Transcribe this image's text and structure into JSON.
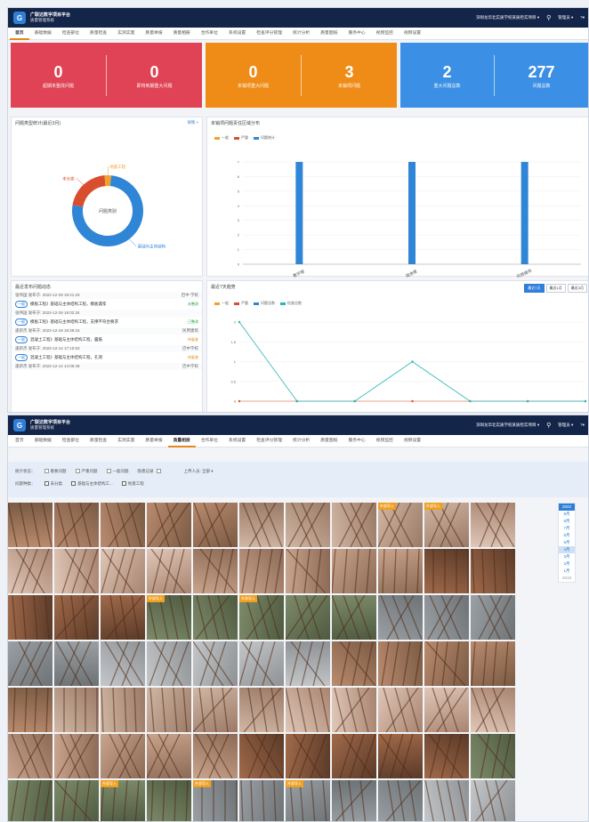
{
  "app": {
    "title": "广联达数字项目平台",
    "subtitle": "质量管理系统",
    "project": "深圳龙华北实质学校某质检实项目",
    "user": "管理员"
  },
  "nav": [
    "首页",
    "基础数据",
    "检查部位",
    "质量检查",
    "实测实量",
    "质量举报",
    "质量相册",
    "合作单位",
    "系统设置",
    "检查评分管理",
    "统计分析",
    "质量图纸",
    "服务中心",
    "视频监控",
    "视频设置"
  ],
  "stats": [
    {
      "v1": "0",
      "l1": "超期未整改问题",
      "v2": "0",
      "l2": "即将到期重大问题"
    },
    {
      "v1": "0",
      "l1": "未销项重大问题",
      "v2": "3",
      "l2": "未销项问题"
    },
    {
      "v1": "2",
      "l1": "重大问题总数",
      "v2": "277",
      "l2": "问题总数"
    }
  ],
  "donut": {
    "title": "问题类型统计(最近3月)",
    "link": "详情 >",
    "center": "问题类别",
    "labels": [
      "地基工程",
      "未分类",
      "基础与主体结构"
    ]
  },
  "bar": {
    "title": "未销项问题责任区域分布",
    "legend": [
      "一般",
      "严重",
      "问题统计"
    ]
  },
  "feed": {
    "title": "最近发布问题动态",
    "items": [
      {
        "who": "张伟国 发布于: 2022-12-29 19:21:33",
        "loc": "巴中 学校",
        "tag": "一般",
        "text": "模板工程》基础与主体结构工程，模板漏浆",
        "st": "未整改",
        "cls": "ok"
      },
      {
        "who": "张伟国 发布于: 2022-12-29 19:02:34",
        "loc": "",
        "tag": "一般",
        "text": "模板工程》基础与主体结构工程，支撑不符合要求",
        "st": "已整改",
        "cls": "ok"
      },
      {
        "who": "逢新杰 发布于: 2022-12-19 18:38:16",
        "loc": "民用建筑",
        "tag": "一般",
        "text": "混凝土工程》基础与主体结构工程，露筋",
        "st": "待复查",
        "cls": "bad"
      },
      {
        "who": "逢新杰 发布于: 2022-12-14 17:15:53",
        "loc": "巴中学校",
        "tag": "一般",
        "text": "混凝土工程》基础与主体结构工程，孔洞",
        "st": "待复查",
        "cls": "bad"
      },
      {
        "who": "逢新杰 发布于: 2022-12-14 14:06:48",
        "loc": "巴中学校",
        "tag": "",
        "text": "",
        "st": "",
        "cls": "ok"
      }
    ]
  },
  "trend": {
    "title": "最近7天趋势",
    "tabs": [
      "最近7天",
      "最近1月",
      "最近3月"
    ],
    "legend": [
      "一般",
      "严重",
      "问题总数",
      "检查总数"
    ]
  },
  "filters": {
    "row1_label": "统计状态：",
    "row1": [
      "重要问题",
      "严重问题",
      "一般问题"
    ],
    "row1_b": "隐患记录",
    "person": "上传人员: 全部 ▾",
    "row2_label": "问题种类：",
    "row2": [
      "未分类",
      "基础与主体结构工...",
      "地基工程"
    ]
  },
  "album": {
    "import_label": "外部导入",
    "year": "2022",
    "months": [
      "9月",
      "8月",
      "7月",
      "6月",
      "5月",
      "4月",
      "3月",
      "2月",
      "1月"
    ],
    "old_year": "2018"
  },
  "chart_data": [
    {
      "type": "pie",
      "title": "问题类型统计(最近3月)",
      "categories": [
        "基础与主体结构",
        "未分类",
        "地基工程"
      ],
      "values": [
        76,
        21,
        3
      ],
      "colors": [
        "#2f86d6",
        "#d84e2e",
        "#f0a22a"
      ]
    },
    {
      "type": "bar",
      "title": "未销项问题责任区域分布",
      "categories": [
        "教学楼",
        "宿舍楼",
        "风雨操场"
      ],
      "series": [
        {
          "name": "一般",
          "values": [
            0,
            0,
            0
          ]
        },
        {
          "name": "严重",
          "values": [
            0,
            0,
            0
          ]
        },
        {
          "name": "问题统计",
          "values": [
            7,
            7,
            7
          ]
        }
      ],
      "ylim": [
        0,
        7
      ],
      "yticks": [
        "0",
        "1",
        "2",
        "3",
        "4",
        "5",
        "6",
        "7"
      ]
    },
    {
      "type": "line",
      "title": "最近7天趋势",
      "series": [
        {
          "name": "问题总数",
          "values": [
            0,
            0,
            0,
            0,
            0,
            0,
            0
          ]
        },
        {
          "name": "检查总数",
          "values": [
            2,
            0,
            0,
            1,
            0,
            0,
            0
          ]
        }
      ],
      "ylim": [
        0,
        2
      ],
      "yticks": [
        "0",
        "0.5",
        "1",
        "1.5",
        "2"
      ]
    }
  ]
}
